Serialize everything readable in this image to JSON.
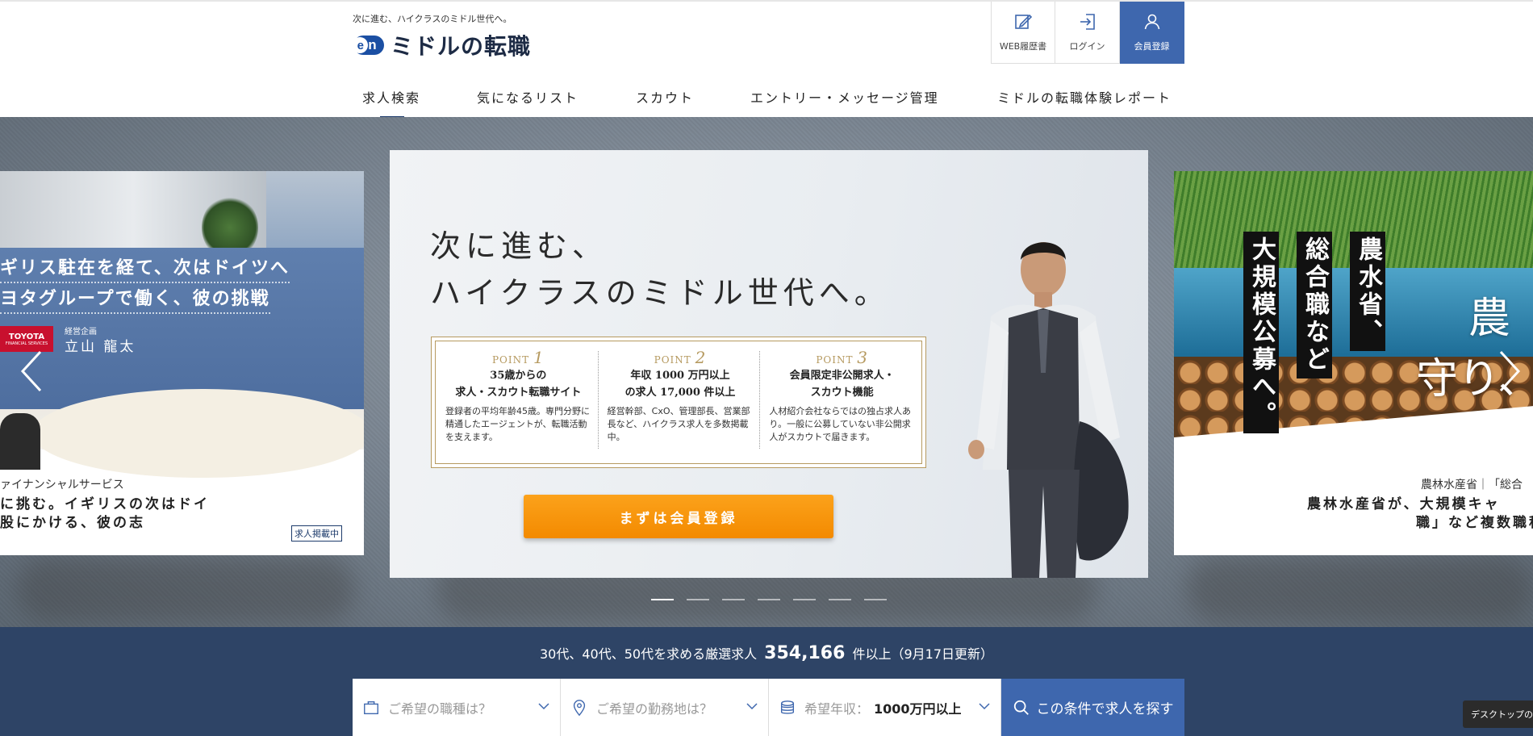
{
  "brand": {
    "tagline": "次に進む、ハイクラスのミドル世代へ。",
    "logo_mark": "en",
    "name": "ミドルの転職"
  },
  "header_buttons": {
    "resume": "WEB履歴書",
    "login": "ログイン",
    "register": "会員登録"
  },
  "nav": {
    "items": [
      "求人検索",
      "気になるリスト",
      "スカウト",
      "エントリー・メッセージ管理",
      "ミドルの転職体験レポート"
    ],
    "active_index": 0
  },
  "slide_left": {
    "headline_1": "ギリス駐在を経て、次はドイツへ",
    "headline_2": "ヨタグループで働く、彼の挑戦",
    "logo_text": "TOYOTA",
    "logo_sub": "FINANCIAL SERVICES",
    "person_role": "経営企画",
    "person_name": "立山 龍太",
    "company": "ァイナンシャルサービス",
    "title_1": "に挑む。イギリスの次はドイ",
    "title_2": "股にかける、彼の志",
    "badge": "求人掲載中"
  },
  "slide_center": {
    "headline_1": "次に進む、",
    "headline_2": "ハイクラスのミドル世代へ。",
    "points": [
      {
        "label": "POINT",
        "num": "1",
        "title_1": "35歳からの",
        "title_2": "求人・スカウト転職サイト",
        "body": "登録者の平均年齢45歳。専門分野に精通したエージェントが、転職活動を支えます。"
      },
      {
        "label": "POINT",
        "num": "2",
        "title_1": "年収 1000 万円以上",
        "title_2": "の求人 17,000 件以上",
        "body": "経営幹部、CxO、管理部長、営業部長など、ハイクラス求人を多数掲載中。"
      },
      {
        "label": "POINT",
        "num": "3",
        "title_1": "会員限定非公開求人・",
        "title_2": "スカウト機能",
        "body": "人材紹介会社ならではの独占求人あり。一般に公募していない非公開求人がスカウトで届きます。"
      }
    ],
    "cta": "まずは会員登録"
  },
  "slide_right": {
    "vertical_1": "農水省、",
    "vertical_2": "総合職など",
    "vertical_3": "大規模公募へ。",
    "big_1": "農",
    "big_2": "守り、",
    "company": "農林水産省｜「総合",
    "title_1": "農林水産省が、大規模キャ",
    "title_2": "職」など複数職種"
  },
  "carousel": {
    "slide_count": 7,
    "active_index": 0
  },
  "search": {
    "count_prefix": "30代、40代、50代を求める厳選求人",
    "count_value": "354,166",
    "count_suffix": "件以上（9月17日更新）",
    "job_placeholder": "ご希望の職種は？",
    "location_placeholder": "ご希望の勤務地は？",
    "salary_label": "希望年収：",
    "salary_value": "1000万円以上",
    "submit": "この条件で求人を探す"
  },
  "tooltip": "デスクトップの表示",
  "colors": {
    "brand_blue": "#3e67ae",
    "navy": "#2e4466",
    "cta_orange": "#f7950e",
    "gold": "#b69a60"
  }
}
